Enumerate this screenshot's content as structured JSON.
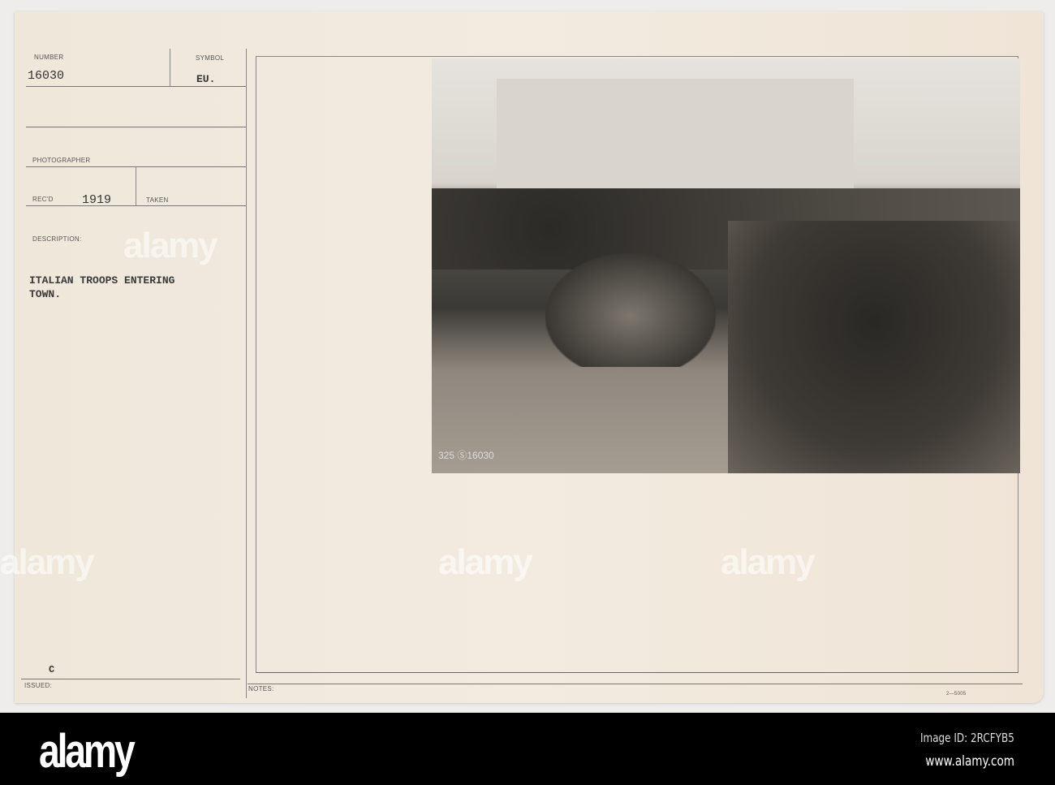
{
  "card": {
    "number_label": "NUMBER",
    "number": "16030",
    "symbol_label": "SYMBOL",
    "symbol": "EU.",
    "photographer_label": "PHOTOGRAPHER",
    "recd_label": "REC'D",
    "recd": "1919",
    "taken_label": "TAKEN",
    "description_label": "DESCRIPTION:",
    "description_line1": "ITALIAN TROOPS ENTERING",
    "description_line2": "TOWN.",
    "issued_label": "ISSUED:",
    "issued_mark": "C",
    "notes_label": "NOTES:",
    "form_number": "2—5005"
  },
  "photo": {
    "negative_number": "325 Ⓢ16030"
  },
  "watermark": {
    "text": "alamy",
    "mark": "a"
  },
  "footer": {
    "logo": "alamy",
    "image_id": "Image ID: 2RCFYB5",
    "url": "www.alamy.com"
  }
}
